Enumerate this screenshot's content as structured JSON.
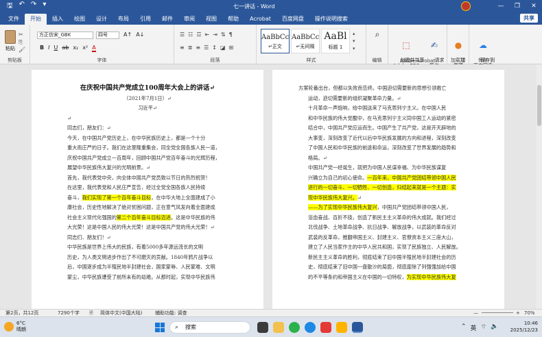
{
  "titlebar": {
    "title": "七一讲话  -  Word",
    "save": "🖫",
    "undo": "↶",
    "redo": "↷",
    "customize": "▾",
    "min": "—",
    "restore": "❐",
    "close": "✕"
  },
  "tabs": [
    "文件",
    "开始",
    "插入",
    "绘图",
    "设计",
    "布局",
    "引用",
    "邮件",
    "审阅",
    "视图",
    "帮助",
    "Acrobat",
    "百度网盘",
    "操作说明搜索"
  ],
  "share_label": "共享",
  "ribbon": {
    "clipboard": {
      "label": "剪贴板",
      "paste": "粘贴"
    },
    "font": {
      "label": "字体",
      "name": "方正仿宋_GBK",
      "size": "四号",
      "bold": "B",
      "italic": "I",
      "underline": "U",
      "strike": "ab",
      "sub": "x₂",
      "sup": "x²",
      "grow": "A↑",
      "shrink": "A↓",
      "color": "A"
    },
    "paragraph": {
      "label": "段落"
    },
    "styles": {
      "label": "样式",
      "cards": [
        {
          "sample": "AaBbCc",
          "name": "↵正文"
        },
        {
          "sample": "AaBbCc",
          "name": "↵无间隔"
        },
        {
          "sample": "AaBl",
          "name": "标题 1"
        }
      ]
    },
    "editing": {
      "label": "编辑"
    },
    "acrobat": {
      "label": "Adobe Acrobat",
      "create": "创建并共享\nAdobe PDF",
      "sign": "请求\n签名"
    },
    "addins": {
      "label": "加载项",
      "addin": "加\n载项"
    },
    "save": {
      "label": "保存",
      "baidu": "保存到\n百度网盘"
    }
  },
  "page1": [
    {
      "t": "在庆祝中国共产党成立100周年大会上的讲话↵",
      "cls": "title-line"
    },
    {
      "t": "（2021年7月1日）↵",
      "cls": "center"
    },
    {
      "t": "习近平↵",
      "cls": "center"
    },
    {
      "t": "↵",
      "cls": ""
    },
    {
      "t": "同志们，朋友们：↵",
      "cls": ""
    },
    {
      "t": "今天，在中国共产党历史上，在中华民族历史上，都是一个十分",
      "cls": ""
    },
    {
      "t": "重大而庄严的日子。我们在这里隆重集会，同全党全国各族人民一道，",
      "cls": ""
    },
    {
      "t": "庆祝中国共产党成立一百周年，回顾中国共产党百年奋斗的光辉历程，",
      "cls": ""
    },
    {
      "t": "展望中华民族伟大复兴的光明前景。↵",
      "cls": ""
    },
    {
      "t": "首先，我代表党中央，向全体中国共产党员致以节日的热烈祝贺！",
      "cls": ""
    },
    {
      "t": "在这里，我代表党和人民庄严宣告，经过全党全国各族人民持续",
      "cls": ""
    },
    {
      "t": "奋斗，",
      "hl": "我们实现了第一个百年奋斗目标",
      "after": "，在中华大地上全面建成了小",
      "cls": ""
    },
    {
      "t": "康社会，历史性地解决了绝对贫困问题，正在意气风发向着全面建成",
      "cls": ""
    },
    {
      "t": "社会主义现代化强国的",
      "hl": "第二个百年奋斗目标迈进",
      "after": "。这是中华民族的伟",
      "cls": ""
    },
    {
      "t": "大光荣！这是中国人民的伟大光荣！这是中国共产党的伟大光荣！↵",
      "cls": ""
    },
    {
      "t": "同志们、朋友们！↵",
      "cls": ""
    },
    {
      "t": "中华民族是世界上伟大的民族，有着5000多年源远流长的文明",
      "cls": ""
    },
    {
      "t": "历史，为人类文明进步作出了不可磨灭的贡献。1840年鸦片战争以",
      "cls": ""
    },
    {
      "t": "后，中国逐步成为半殖民地半封建社会，国家蒙辱、人民蒙难、文明",
      "cls": ""
    },
    {
      "t": "蒙尘，中华民族遭受了前所未有的劫难。从那时起，实现中华民族伟",
      "cls": ""
    }
  ],
  "page2": [
    {
      "t": "方案轮番出台，但都以失败而告终。中国迫切需要新的思想引领救亡",
      "cls": ""
    },
    {
      "t": "运动，迫切需要新的组织凝聚革命力量。↵",
      "cls": ""
    },
    {
      "t": "十月革命一声炮响，给中国送来了马克思列宁主义。在中国人民",
      "cls": ""
    },
    {
      "t": "和中华民族的伟大觉醒中，在马克思列宁主义同中国工人运动的紧密",
      "cls": ""
    },
    {
      "t": "结合中，中国共产党应运而生。中国产生了共产党，这是开天辟地的",
      "cls": ""
    },
    {
      "t": "大事变，深刻改变了近代以后中华民族发展的方向和进程，深刻改变",
      "cls": ""
    },
    {
      "t": "了中国人民和中华民族的前途和命运，深刻改变了世界发展的趋势和",
      "cls": ""
    },
    {
      "t": "格局。↵",
      "cls": ""
    },
    {
      "t": "中国共产党一经诞生，就把为中国人民谋幸福、为中华民族谋复",
      "cls": ""
    },
    {
      "t": "兴确立为自己的初心使命。",
      "hl": "一百年来，中国共产党团结带领中国人民",
      "after": "",
      "cls": ""
    },
    {
      "t": "",
      "hl": "进行的一切奋斗、一切牺牲、一切创造，归结起来就是一个主题：实",
      "after": "",
      "cls": ""
    },
    {
      "t": "",
      "hl": "现中华民族伟大复兴。",
      "after": "↵",
      "cls": ""
    },
    {
      "t": "",
      "hl": "——为了实现中华民族伟大复兴",
      "after": "，中国共产党团结带领中国人民，",
      "cls": ""
    },
    {
      "t": "浴血奋战、百折不挠，创造了新民主主义革命的伟大成就。我们经过",
      "cls": ""
    },
    {
      "t": "北伐战争、土地革命战争、抗日战争、解放战争，以武装的革命反对",
      "cls": ""
    },
    {
      "t": "武装的反革命，推翻帝国主义、封建主义、官僚资本主义三座大山，",
      "cls": ""
    },
    {
      "t": "建立了人民当家作主的中华人民共和国，实现了民族独立、人民解放。",
      "cls": ""
    },
    {
      "t": "新民主主义革命的胜利，彻底结束了旧中国半殖民地半封建社会的历",
      "cls": ""
    },
    {
      "t": "史，彻底结束了旧中国一盘散沙的局面，彻底废除了列强强加给中国",
      "cls": ""
    },
    {
      "t": "的不平等条约和帝国主义在中国的一切特权，",
      "hl": "为实现中华民族伟大复",
      "after": "",
      "cls": ""
    }
  ],
  "status": {
    "page": "第2页，共12页",
    "words": "7290个字",
    "check": "🗎",
    "lang": "简体中文(中国大陆)",
    "access": "辅助功能: 调查",
    "zoom": "70%",
    "zoom_minus": "—",
    "zoom_plus": "+"
  },
  "taskbar": {
    "temp": "6°C",
    "weather": "晴朗",
    "search_placeholder": "搜索",
    "lang": "英",
    "time": "10:46",
    "date": "2025/12/23"
  },
  "colors": {
    "accent": "#2b579a",
    "highlight": "#ffff00"
  }
}
